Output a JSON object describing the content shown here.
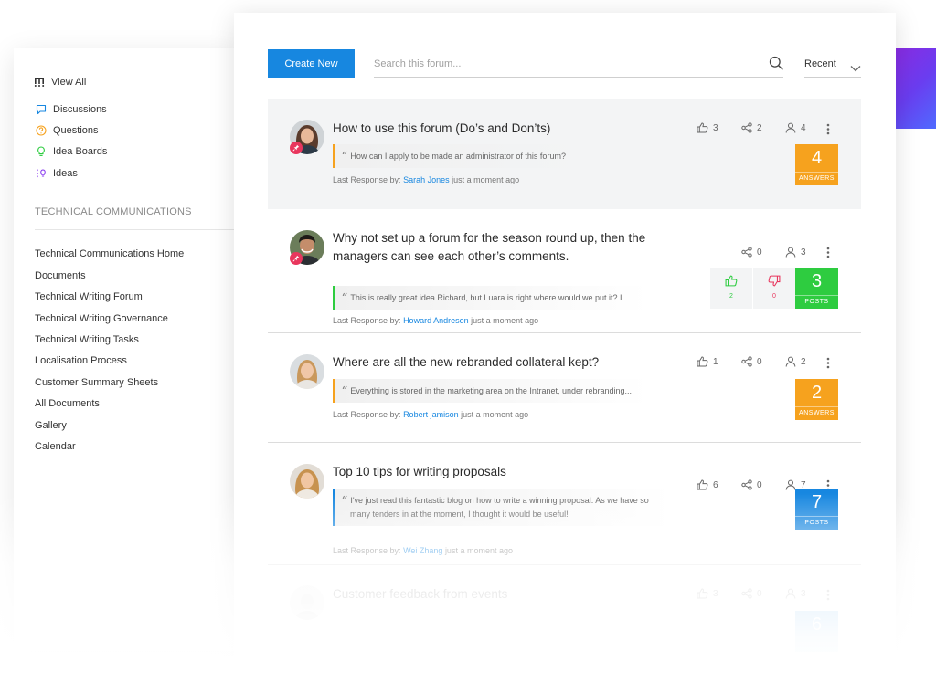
{
  "colors": {
    "primary": "#1787e0",
    "answers_orange": "#f6a21e",
    "posts_green": "#2ecc40",
    "posts_blue": "#1787e0",
    "pin_red": "#e8365d",
    "quote_orange": "#f6a21e",
    "quote_green": "#2ecc40",
    "quote_blue": "#1787e0"
  },
  "sidebar": {
    "view_all": "View All",
    "categories": [
      {
        "label": "Discussions",
        "icon": "chat-bubble-icon",
        "color": "#1787e0"
      },
      {
        "label": "Questions",
        "icon": "question-circle-icon",
        "color": "#f6a21e"
      },
      {
        "label": "Idea Boards",
        "icon": "lightbulb-icon",
        "color": "#2ecc40"
      },
      {
        "label": "Ideas",
        "icon": "idea-list-icon",
        "color": "#8a3df0"
      }
    ],
    "section_heading": "TECHNICAL COMMUNICATIONS",
    "links": [
      "Technical Communications Home",
      "Documents",
      "Technical Writing Forum",
      "Technical Writing Governance",
      "Technical Writing Tasks",
      "Localisation Process",
      "Customer Summary Sheets",
      "All Documents",
      "Gallery",
      "Calendar"
    ]
  },
  "toolbar": {
    "create_label": "Create New",
    "search_placeholder": "Search this forum...",
    "sort_label": "Recent"
  },
  "threads": [
    {
      "title": "How to use this forum (Do’s and Don’ts)",
      "pinned": true,
      "quote": "How can I apply to be made an administrator of this forum?",
      "last_label": "Last Response by:",
      "last_user": "Sarah Jones",
      "time": "just a moment ago",
      "likes": "3",
      "shares": "2",
      "followers": "4",
      "count": "4",
      "count_label": "ANSWERS",
      "count_color": "#f6a21e",
      "quote_color": "#f6a21e"
    },
    {
      "title_line1": "Why not set up a forum for the season round up, then the",
      "title_line2": "managers can see each other’s comments.",
      "pinned": true,
      "quote": "This is really great idea Richard, but Luara is right where would we put it? I...",
      "last_label": "Last Response by:",
      "last_user": "Howard Andreson",
      "time": "just a moment ago",
      "shares": "0",
      "followers": "3",
      "up_votes": "2",
      "down_votes": "0",
      "count": "3",
      "count_label": "POSTS",
      "count_color": "#2ecc40",
      "quote_color": "#2ecc40"
    },
    {
      "title": "Where are all the new rebranded collateral kept?",
      "pinned": false,
      "quote": "Everything is stored in the marketing area on the Intranet, under rebranding...",
      "last_label": "Last Response by:",
      "last_user": "Robert jamison",
      "time": "just a moment ago",
      "likes": "1",
      "shares": "0",
      "followers": "2",
      "count": "2",
      "count_label": "ANSWERS",
      "count_color": "#f6a21e",
      "quote_color": "#f6a21e"
    },
    {
      "title": "Top 10 tips for writing proposals",
      "pinned": false,
      "quote_line1": "I've just read this fantastic blog on how to write a winning proposal. As we have so",
      "quote_line2": "many tenders in at the moment, I thought it would be useful!",
      "last_label": "Last Response by:",
      "last_user": "Wei Zhang",
      "time": "just a moment ago",
      "likes": "6",
      "shares": "0",
      "followers": "7",
      "count": "7",
      "count_label": "POSTS",
      "count_color": "#1787e0",
      "quote_color": "#1787e0"
    },
    {
      "title": "Customer feedback from events",
      "pinned": false,
      "likes": "3",
      "shares": "0",
      "followers": "3",
      "count": "6",
      "count_color": "#1787e0"
    }
  ]
}
